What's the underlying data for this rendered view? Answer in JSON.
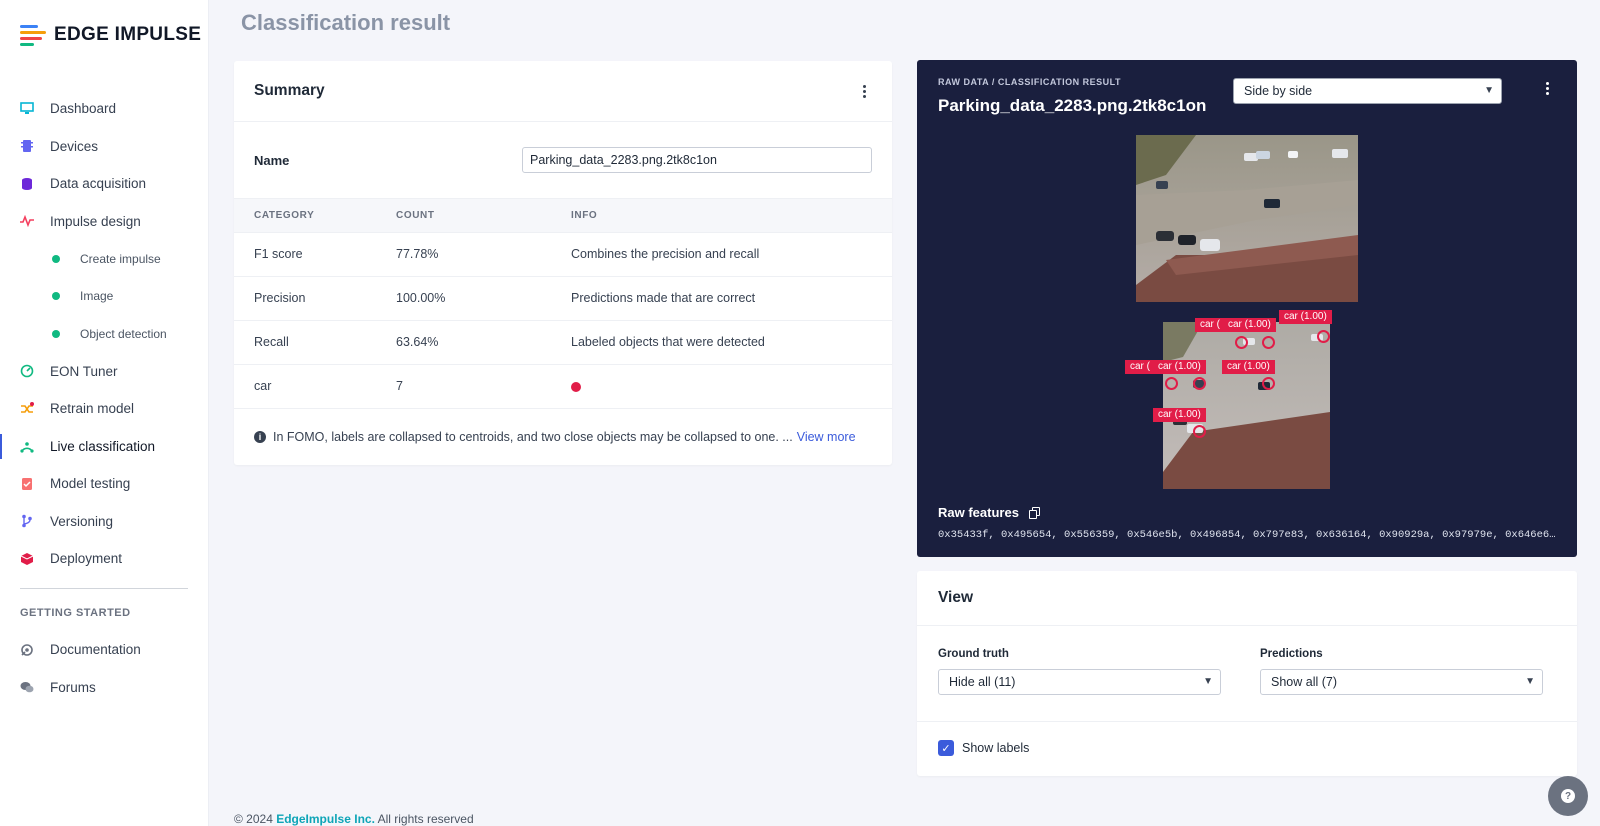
{
  "app": {
    "logo_text": "EDGE IMPULSE"
  },
  "sidebar": {
    "items": [
      {
        "label": "Dashboard",
        "icon": "monitor-icon",
        "color": "#06b6d4"
      },
      {
        "label": "Devices",
        "icon": "chip-icon",
        "color": "#6366f1"
      },
      {
        "label": "Data acquisition",
        "icon": "database-icon",
        "color": "#6d28d9"
      },
      {
        "label": "Impulse design",
        "icon": "pulse-icon",
        "color": "#f43f5e"
      },
      {
        "label": "Create impulse",
        "icon": "dot-icon",
        "color": "#10b981"
      },
      {
        "label": "Image",
        "icon": "dot-icon",
        "color": "#10b981"
      },
      {
        "label": "Object detection",
        "icon": "dot-icon",
        "color": "#10b981"
      },
      {
        "label": "EON Tuner",
        "icon": "tuner-icon",
        "color": "#10b981"
      },
      {
        "label": "Retrain model",
        "icon": "shuffle-icon",
        "color": "#f59e0b"
      },
      {
        "label": "Live classification",
        "icon": "live-icon",
        "color": "#10b981"
      },
      {
        "label": "Model testing",
        "icon": "test-icon",
        "color": "#f87171"
      },
      {
        "label": "Versioning",
        "icon": "branch-icon",
        "color": "#6366f1"
      },
      {
        "label": "Deployment",
        "icon": "box-icon",
        "color": "#e11d48"
      }
    ],
    "section_title": "GETTING STARTED",
    "getting_started": [
      {
        "label": "Documentation",
        "icon": "docs-icon"
      },
      {
        "label": "Forums",
        "icon": "chat-icon"
      }
    ]
  },
  "page": {
    "title": "Classification result"
  },
  "summary": {
    "title": "Summary",
    "name_label": "Name",
    "name_value": "Parking_data_2283.png.2tk8c1on",
    "columns": [
      "CATEGORY",
      "COUNT",
      "INFO"
    ],
    "rows": [
      {
        "category": "F1 score",
        "count": "77.78%",
        "info": "Combines the precision and recall"
      },
      {
        "category": "Precision",
        "count": "100.00%",
        "info": "Predictions made that are correct"
      },
      {
        "category": "Recall",
        "count": "63.64%",
        "info": "Labeled objects that were detected"
      },
      {
        "category": "car",
        "count": "7",
        "info": ""
      }
    ],
    "note": "In FOMO, labels are collapsed to centroids, and two close objects may be collapsed to one. ...",
    "note_link": "View more"
  },
  "raw_panel": {
    "breadcrumb": "RAW DATA / CLASSIFICATION RESULT",
    "title": "Parking_data_2283.png.2tk8c1on",
    "view_mode": "Side by side",
    "predictions": [
      "car (",
      "car (1.00)",
      "car (1.00)",
      "car (",
      "car (1.00)",
      "car (1.00)",
      "car (1.00)"
    ],
    "raw_features_label": "Raw features",
    "raw_features": "0x35433f, 0x495654, 0x556359, 0x546e5b, 0x496854, 0x797e83, 0x636164, 0x90929a, 0x97979e, 0x646e6d, 0x..."
  },
  "view": {
    "title": "View",
    "ground_truth_label": "Ground truth",
    "ground_truth_value": "Hide all (11)",
    "predictions_label": "Predictions",
    "predictions_value": "Show all (7)",
    "show_labels": "Show labels"
  },
  "footer": {
    "copyright": "© 2024",
    "brand": "EdgeImpulse Inc.",
    "rights": "All rights reserved"
  }
}
